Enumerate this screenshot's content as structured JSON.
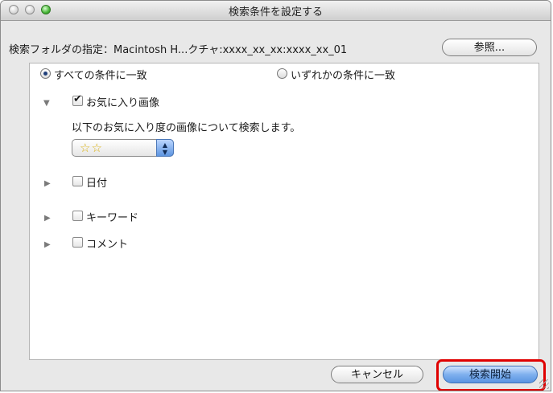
{
  "window": {
    "title": "検索条件を設定する"
  },
  "folder": {
    "label": "検索フォルダの指定：Macintosh H...クチャ:xxxx_xx_xx:xxxx_xx_01",
    "browse_label": "参照..."
  },
  "match": {
    "all_label": "すべての条件に一致",
    "any_label": "いずれかの条件に一致",
    "selected": "all"
  },
  "conditions": [
    {
      "label": "お気に入り画像",
      "checked": true,
      "expanded": true,
      "description": "以下のお気に入り度の画像について検索します。",
      "rating_value": "☆☆"
    },
    {
      "label": "日付",
      "checked": false,
      "expanded": false
    },
    {
      "label": "キーワード",
      "checked": false,
      "expanded": false
    },
    {
      "label": "コメント",
      "checked": false,
      "expanded": false
    }
  ],
  "buttons": {
    "cancel_label": "キャンセル",
    "start_label": "検索開始"
  },
  "icons": {
    "expanded": "triangle-down-icon",
    "collapsed": "triangle-right-icon",
    "stepper": "up-down-arrows-icon"
  },
  "colors": {
    "highlight": "#e00000",
    "default_button": "#5a94e2",
    "zoom_button": "#47b536"
  }
}
